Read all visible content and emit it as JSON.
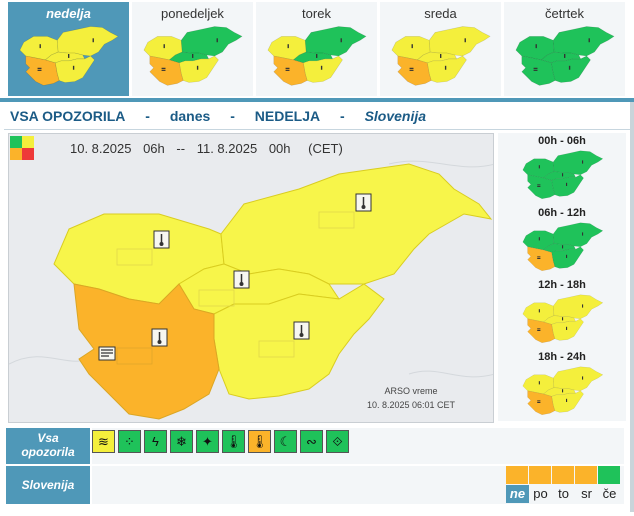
{
  "days": [
    {
      "label": "nedelja",
      "active": true,
      "regions": [
        "#f4ef3c",
        "#f4ef3c",
        "#f4ef3c",
        "#f4ef3c",
        "#fbb32a"
      ]
    },
    {
      "label": "ponedeljek",
      "active": false,
      "regions": [
        "#f4ef3c",
        "#1fc25a",
        "#1fc25a",
        "#f4ef3c",
        "#fbb32a"
      ]
    },
    {
      "label": "torek",
      "active": false,
      "regions": [
        "#f4ef3c",
        "#1fc25a",
        "#1fc25a",
        "#f4ef3c",
        "#fbb32a"
      ]
    },
    {
      "label": "sreda",
      "active": false,
      "regions": [
        "#f4ef3c",
        "#f4ef3c",
        "#f4ef3c",
        "#f4ef3c",
        "#fbb32a"
      ]
    },
    {
      "label": "četrtek",
      "active": false,
      "regions": [
        "#1fc25a",
        "#1fc25a",
        "#1fc25a",
        "#1fc25a",
        "#1fc25a"
      ]
    }
  ],
  "title": {
    "scope": "VSA OPOZORILA",
    "sep1": "-",
    "when": "danes",
    "sep2": "-",
    "day": "NEDELJA",
    "sep3": "-",
    "region": "Slovenija"
  },
  "validity": {
    "from_date": "10. 8.2025",
    "from_hour": "06h",
    "dash": "--",
    "to_date": "11. 8.2025",
    "to_hour": "00h",
    "tz": "(CET)"
  },
  "main_map": {
    "regions": [
      "#f7f54a",
      "#f7f54a",
      "#f7f54a",
      "#f7f54a",
      "#fbb32a"
    ]
  },
  "credit": {
    "line1": "ARSO vreme",
    "line2": "10. 8.2025  06:01 CET"
  },
  "legend_colors": [
    "#1fc25a",
    "#f4ef3c",
    "#fbb32a",
    "#ee3939"
  ],
  "periods": [
    {
      "label": "00h - 06h",
      "regions": [
        "#1fc25a",
        "#1fc25a",
        "#1fc25a",
        "#1fc25a",
        "#1fc25a"
      ]
    },
    {
      "label": "06h - 12h",
      "regions": [
        "#1fc25a",
        "#1fc25a",
        "#1fc25a",
        "#1fc25a",
        "#fbb32a"
      ]
    },
    {
      "label": "12h - 18h",
      "regions": [
        "#f4ef3c",
        "#f4ef3c",
        "#f4ef3c",
        "#f4ef3c",
        "#fbb32a"
      ]
    },
    {
      "label": "18h - 24h",
      "regions": [
        "#f4ef3c",
        "#f4ef3c",
        "#f4ef3c",
        "#f4ef3c",
        "#fbb32a"
      ]
    }
  ],
  "hazards_label_1": "Vsa",
  "hazards_label_2": "opozorila",
  "hazards": [
    {
      "name": "wind-icon",
      "glyph": "≋",
      "color": "#f4ef3c"
    },
    {
      "name": "rain-icon",
      "glyph": "⁘",
      "color": "#1fc25a"
    },
    {
      "name": "thunderstorm-icon",
      "glyph": "ϟ",
      "color": "#1fc25a"
    },
    {
      "name": "snow-icon",
      "glyph": "❄",
      "color": "#1fc25a"
    },
    {
      "name": "fog-icon",
      "glyph": "✦",
      "color": "#1fc25a"
    },
    {
      "name": "low-temperature-icon",
      "glyph": "🌡",
      "color": "#1fc25a"
    },
    {
      "name": "high-temperature-icon",
      "glyph": "🌡",
      "color": "#fbb32a"
    },
    {
      "name": "forest-fire-icon",
      "glyph": "☾",
      "color": "#1fc25a"
    },
    {
      "name": "coastal-event-icon",
      "glyph": "∾",
      "color": "#1fc25a"
    },
    {
      "name": "avalanche-icon",
      "glyph": "⟐",
      "color": "#1fc25a"
    }
  ],
  "region_row_label": "Slovenija",
  "week_strip": [
    {
      "label": "ne",
      "color": "#fbb32a",
      "active": true
    },
    {
      "label": "po",
      "color": "#fbb32a",
      "active": false
    },
    {
      "label": "to",
      "color": "#fbb32a",
      "active": false
    },
    {
      "label": "sr",
      "color": "#fbb32a",
      "active": false
    },
    {
      "label": "če",
      "color": "#1fc25a",
      "active": false
    }
  ]
}
